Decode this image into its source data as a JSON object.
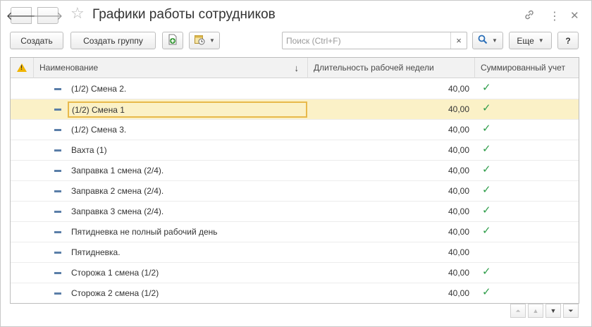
{
  "window": {
    "title": "Графики работы сотрудников"
  },
  "toolbar": {
    "create_label": "Создать",
    "create_group_label": "Создать группу",
    "search_placeholder": "Поиск (Ctrl+F)",
    "more_label": "Еще",
    "help_label": "?"
  },
  "table": {
    "headers": {
      "name": "Наименование",
      "duration": "Длительность рабочей недели",
      "summary": "Суммированный учет"
    },
    "rows": [
      {
        "name": "(1/2)  Смена 2.",
        "duration": "40,00",
        "summary": "✓"
      },
      {
        "name": "(1/2) Смена 1",
        "duration": "40,00",
        "summary": "✓"
      },
      {
        "name": "(1/2) Смена 3.",
        "duration": "40,00",
        "summary": "✓"
      },
      {
        "name": "Вахта (1)",
        "duration": "40,00",
        "summary": "✓"
      },
      {
        "name": "Заправка 1 смена (2/4).",
        "duration": "40,00",
        "summary": "✓"
      },
      {
        "name": "Заправка 2 смена (2/4).",
        "duration": "40,00",
        "summary": "✓"
      },
      {
        "name": "Заправка 3 смена (2/4).",
        "duration": "40,00",
        "summary": "✓"
      },
      {
        "name": "Пятидневка не полный рабочий день",
        "duration": "40,00",
        "summary": "✓"
      },
      {
        "name": "Пятидневка.",
        "duration": "40,00",
        "summary": ""
      },
      {
        "name": "Сторожа 1 смена (1/2)",
        "duration": "40,00",
        "summary": "✓"
      },
      {
        "name": "Сторожа 2 смена (1/2)",
        "duration": "40,00",
        "summary": "✓"
      }
    ]
  },
  "icons": {
    "back": "arrow-left-icon",
    "forward": "arrow-right-icon",
    "favorite": "star-icon",
    "link": "link-icon",
    "more": "more-vertical-icon",
    "close": "close-icon",
    "add_item": "add-document-icon",
    "schedule": "calendar-clock-icon",
    "search": "search-icon",
    "warning": "warning-icon",
    "sort": "sort-down-icon",
    "row": "item-icon",
    "check": "check-icon"
  },
  "colors": {
    "selected_row": "#fbf1c7",
    "selected_border": "#e8b94b",
    "check": "#2e9d49",
    "row_icon": "#5a7ea8",
    "warning": "#f0b400"
  }
}
